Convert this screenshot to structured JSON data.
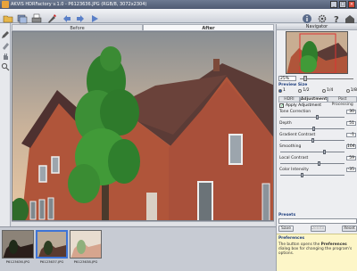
{
  "window": {
    "title": "AKVIS HDRFactory v.1.0 - P6123636.JPG (RGB/8, 3072x2304)",
    "minimize": "_",
    "maximize": "□",
    "close": "×"
  },
  "toolbar": {
    "icons": [
      "open-icon",
      "batch-icon",
      "print-icon",
      "brush-icon",
      "undo-icon",
      "redo-icon",
      "run-icon",
      "info-icon",
      "settings-icon",
      "help-icon",
      "home-icon"
    ]
  },
  "canvas": {
    "tab_before": "Before",
    "tab_after": "After"
  },
  "navigator": {
    "title": "Navigator",
    "zoom": "25%"
  },
  "preview_size": {
    "label": "Preview Size",
    "options": [
      "1",
      "1/2",
      "1/4",
      "1/8"
    ],
    "selected_index": 0
  },
  "subtabs": [
    "HDRI",
    "Adjustment",
    "Post Processing"
  ],
  "apply_adjustment": "Apply Adjustment",
  "sliders": [
    {
      "name": "Tone Correction",
      "value": "30"
    },
    {
      "name": "Depth",
      "value": "51"
    },
    {
      "name": "Gradient Contrast",
      "value": "-1"
    },
    {
      "name": "Smoothing",
      "value": "104"
    },
    {
      "name": "Local Contrast",
      "value": "59"
    },
    {
      "name": "Color Intensity",
      "value": "-35"
    }
  ],
  "presets": {
    "label": "Presets",
    "save": "Save",
    "delete": "Delete",
    "reset": "Reset"
  },
  "help": {
    "heading": "Preferences",
    "text_before": "The button opens the",
    "text_bold": "Preferences",
    "text_after": "dialog box for changing the program's options."
  },
  "filmstrip": {
    "files": [
      "P6123636.JPG",
      "P6123637.JPG",
      "P6123638.JPG"
    ]
  }
}
